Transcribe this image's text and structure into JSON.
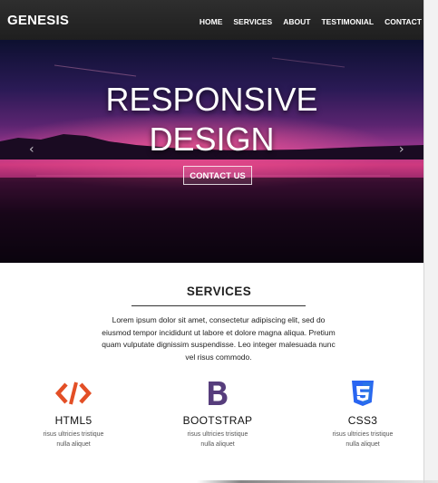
{
  "navbar": {
    "brand": "GENESIS",
    "items": [
      "HOME",
      "SERVICES",
      "ABOUT",
      "TESTIMONIAL",
      "CONTACT"
    ]
  },
  "hero": {
    "title_line1": "RESPONSIVE",
    "title_line2": "DESIGN",
    "cta_label": "CONTACT US",
    "prev_arrow": "‹",
    "next_arrow": "›"
  },
  "services": {
    "heading": "SERVICES",
    "description": "Lorem ipsum dolor sit amet, consectetur adipiscing elit, sed do eiusmod tempor incididunt ut labore et dolore magna aliqua. Pretium quam vulputate dignissim suspendisse. Leo integer malesuada nunc vel risus commodo.",
    "features": [
      {
        "icon": "code-icon",
        "title": "HTML5",
        "description": "risus ultricies tristique nulla aliquet",
        "color": "#e34f26"
      },
      {
        "icon": "bootstrap-icon",
        "title": "BOOTSTRAP",
        "description": "risus ultricies tristique nulla aliquet",
        "color": "#563d7c"
      },
      {
        "icon": "css3-icon",
        "title": "CSS3",
        "description": "risus ultricies tristique nulla aliquet",
        "color": "#2965f1"
      }
    ]
  },
  "colors": {
    "navbar": "#262626",
    "accent_pink": "#d2387e",
    "html_orange": "#e34f26",
    "bootstrap_purple": "#563d7c",
    "css_blue": "#2965f1"
  }
}
